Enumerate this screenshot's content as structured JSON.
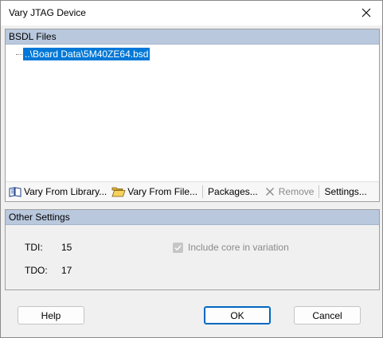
{
  "window": {
    "title": "Vary JTAG Device"
  },
  "bsdl": {
    "header": "BSDL Files",
    "selected_file": "..\\Board Data\\5M40ZE64.bsd"
  },
  "toolbar": {
    "vary_library": "Vary From Library...",
    "vary_file": "Vary From File...",
    "packages": "Packages...",
    "remove": "Remove",
    "settings": "Settings..."
  },
  "other": {
    "header": "Other Settings",
    "tdi_label": "TDI:",
    "tdi_value": "15",
    "tdo_label": "TDO:",
    "tdo_value": "17",
    "include_core_label": "Include core in variation",
    "include_core_checked": true,
    "include_core_enabled": false
  },
  "buttons": {
    "help": "Help",
    "ok": "OK",
    "cancel": "Cancel"
  },
  "colors": {
    "selection": "#0078d7",
    "header_bg": "#b9c8dd",
    "default_button_border": "#0067c0"
  },
  "icons": [
    "close-icon",
    "library-book-icon",
    "folder-open-icon",
    "remove-x-icon",
    "checkmark-icon"
  ]
}
